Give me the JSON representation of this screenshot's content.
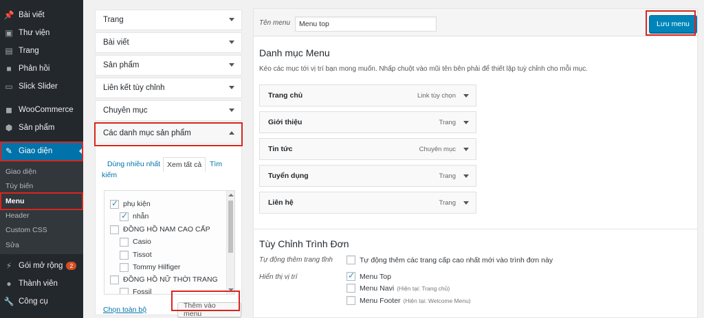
{
  "sidebar": {
    "items": [
      {
        "label": "Bài viết",
        "icon": "pin-icon"
      },
      {
        "label": "Thư viện",
        "icon": "media-icon"
      },
      {
        "label": "Trang",
        "icon": "page-icon"
      },
      {
        "label": "Phản hồi",
        "icon": "comment-icon"
      },
      {
        "label": "Slick Slider",
        "icon": "slider-icon"
      },
      {
        "label": "WooCommerce",
        "icon": "woocommerce-icon"
      },
      {
        "label": "Sản phẩm",
        "icon": "box-icon"
      },
      {
        "label": "Giao diện",
        "icon": "brush-icon"
      },
      {
        "label": "Gói mở rộng",
        "icon": "plugin-icon",
        "badge": "2"
      },
      {
        "label": "Thành viên",
        "icon": "user-icon"
      },
      {
        "label": "Công cụ",
        "icon": "wrench-icon"
      }
    ],
    "submenu": [
      "Giao diện",
      "Tùy biến",
      "Menu",
      "Header",
      "Custom CSS",
      "Sửa"
    ]
  },
  "accordion": {
    "sections": [
      "Trang",
      "Bài viết",
      "Sản phẩm",
      "Liên kết tùy chỉnh",
      "Chuyên mục",
      "Các danh mục sản phẩm"
    ],
    "tabs": {
      "most_used": "Dùng nhiều nhất",
      "view_all": "Xem tất cả",
      "search_1": "Tìm",
      "search_2": "kiếm"
    },
    "checklist": [
      {
        "label": "phụ kiện",
        "checked": true
      },
      {
        "label": "nhẫn",
        "checked": true
      },
      {
        "label": "ĐỒNG HỒ NAM CAO CẤP",
        "checked": false
      },
      {
        "label": "Casio",
        "checked": false
      },
      {
        "label": "Tissot",
        "checked": false
      },
      {
        "label": "Tommy Hilfiger",
        "checked": false
      },
      {
        "label": "ĐỒNG HỒ NỮ THỜI TRANG",
        "checked": false
      },
      {
        "label": "Fossil",
        "checked": false
      }
    ],
    "select_all": "Chọn toàn bộ",
    "add_to_menu": "Thêm vào menu"
  },
  "menu": {
    "name_label": "Tên menu",
    "name_value": "Menu top",
    "save_label": "Lưu menu",
    "structure_title": "Danh mục Menu",
    "structure_desc": "Kéo các mục tới vị trí bạn mong muốn. Nhấp chuột vào mũi tên bên phải để thiết lập tuỳ chỉnh cho mỗi mục.",
    "items": [
      {
        "label": "Trang chủ",
        "type": "Link tùy chọn"
      },
      {
        "label": "Giới thiệu",
        "type": "Trang"
      },
      {
        "label": "Tin tức",
        "type": "Chuyên mục"
      },
      {
        "label": "Tuyển dụng",
        "type": "Trang"
      },
      {
        "label": "Liên hệ",
        "type": "Trang"
      }
    ],
    "settings_title": "Tùy Chỉnh Trình Đơn",
    "auto_add_label": "Tự động thêm trang tĩnh",
    "auto_add_option": "Tự động thêm các trang cấp cao nhất mới vào trình đơn này",
    "locations_label": "Hiển thị vị trí",
    "locations": [
      {
        "label": "Menu Top",
        "note": "",
        "checked": true
      },
      {
        "label": "Menu Navi",
        "note": "(Hiện tại: Trang chủ)",
        "checked": false
      },
      {
        "label": "Menu Footer",
        "note": "(Hiện tại: Welcome Menu)",
        "checked": false
      }
    ]
  },
  "colors": {
    "accent": "#0073aa",
    "highlight": "#d9251d",
    "sidebar_bg": "#23282d"
  }
}
